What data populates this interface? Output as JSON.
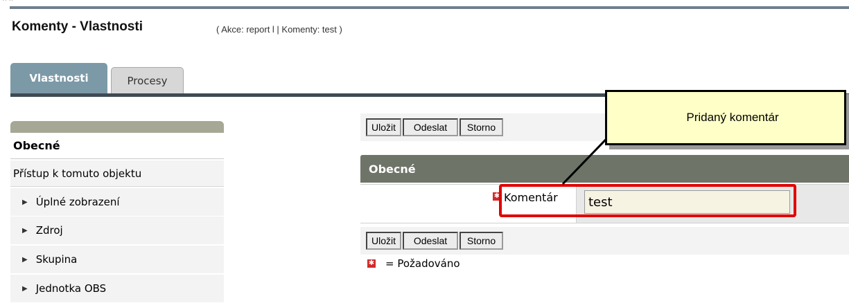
{
  "header": {
    "title": "Komenty - Vlastnosti",
    "subtitle": "( Akce: report l | Komenty: test )"
  },
  "tabs": [
    {
      "label": "Vlastnosti",
      "active": true
    },
    {
      "label": "Procesy",
      "active": false
    }
  ],
  "sidebar": {
    "items": [
      {
        "label": "Obecné"
      },
      {
        "label": "Přístup k tomuto objektu"
      },
      {
        "label": "Úplné zobrazení"
      },
      {
        "label": "Zdroj"
      },
      {
        "label": "Skupina"
      },
      {
        "label": "Jednotka OBS"
      }
    ]
  },
  "buttons": {
    "save": "Uložit",
    "send": "Odeslat",
    "cancel": "Storno"
  },
  "section": {
    "title": "Obecné"
  },
  "form": {
    "comment_label": "Komentár",
    "comment_value": "test"
  },
  "legend": {
    "text": "= Požadováno"
  },
  "callout": {
    "text": "Pridaný komentár"
  },
  "icons": {
    "tab_rule_color": "#3f4b53",
    "required_color": "#d32a2a",
    "highlight_color": "#e00000"
  }
}
